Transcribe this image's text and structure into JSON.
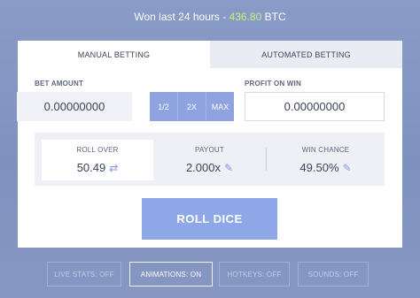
{
  "stats": {
    "label": "Won last 24 hours",
    "dash": "-",
    "amount": "436.80",
    "currency": "BTC"
  },
  "tabs": [
    {
      "label": "MANUAL BETTING"
    },
    {
      "label": "AUTOMATED BETTING"
    }
  ],
  "bet": {
    "label": "BET AMOUNT",
    "value": "0.00000000",
    "buttons": [
      "1/2",
      "2X",
      "MAX"
    ]
  },
  "profit": {
    "label": "PROFIT ON WIN",
    "value": "0.00000000"
  },
  "roll_over": {
    "label": "ROLL OVER",
    "value": "50.49"
  },
  "payout": {
    "label": "PAYOUT",
    "value": "2.000x"
  },
  "win_chance": {
    "label": "WIN CHANCE",
    "value": "49.50%"
  },
  "roll_button": {
    "label": "ROLL DICE"
  },
  "toggles": [
    {
      "label": "LIVE STATS: OFF"
    },
    {
      "label": "ANIMATIONS: ON"
    },
    {
      "label": "HOTKEYS: OFF"
    },
    {
      "label": "SOUNDS: OFF"
    }
  ],
  "colors": {
    "accent": "#8ea7e6",
    "amount": "#c6f27a",
    "background": "#8a9bc7"
  },
  "icons": [
    "swap-arrows-icon",
    "edit-icon"
  ]
}
